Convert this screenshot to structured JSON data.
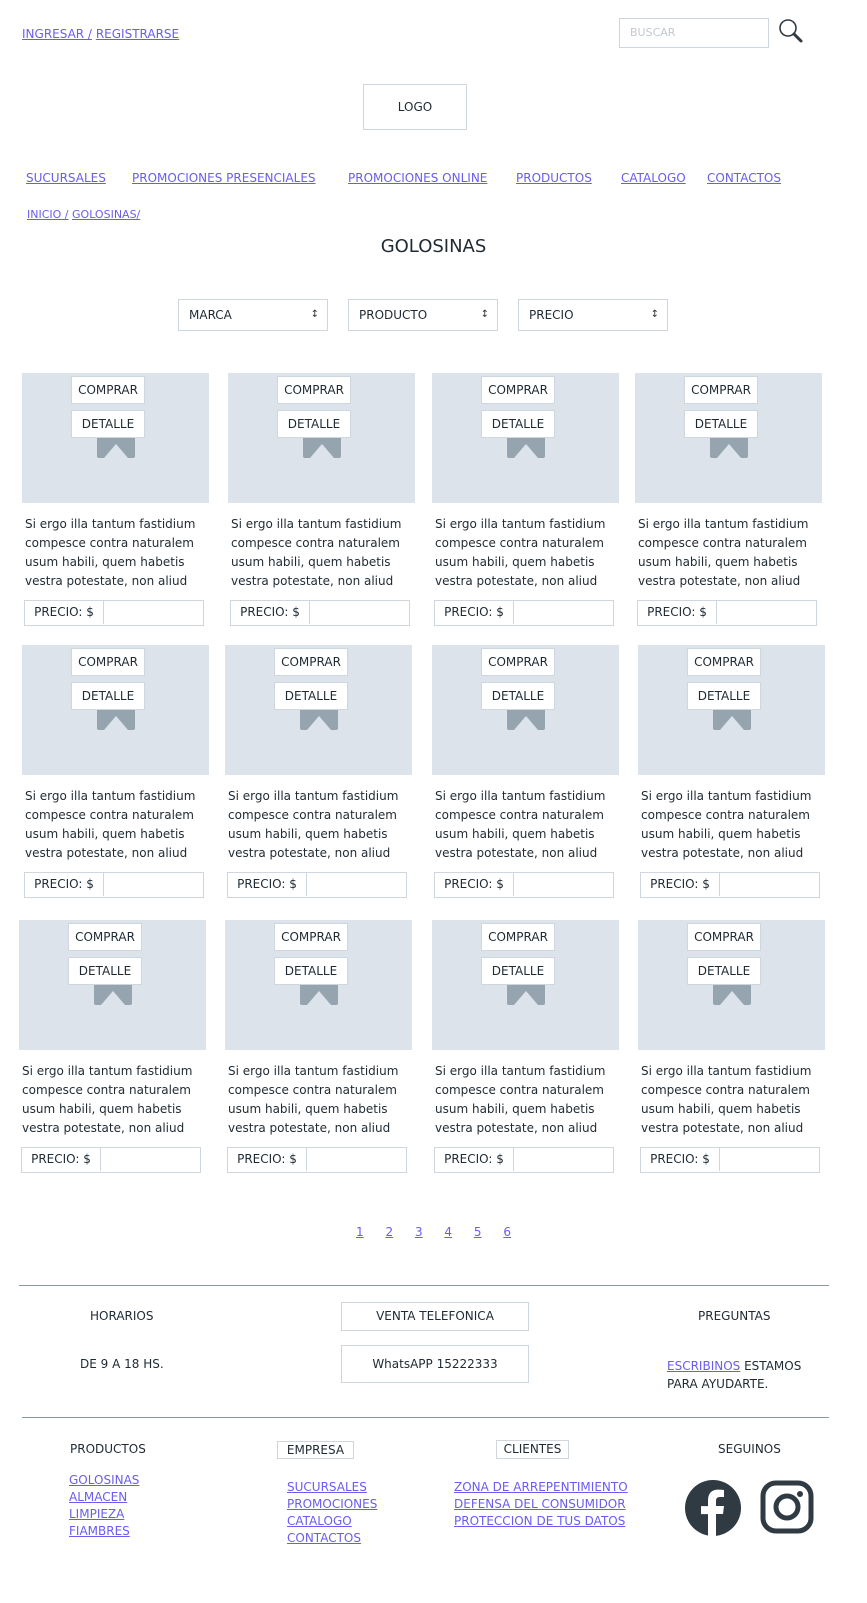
{
  "header": {
    "login": "INGRESAR /",
    "register": "REGISTRARSE",
    "search_placeholder": "BUSCAR",
    "logo": "LOGO"
  },
  "nav": [
    "SUCURSALES",
    "PROMOCIONES PRESENCIALES",
    "PROMOCIONES ONLINE",
    "PRODUCTOS",
    "CATALOGO",
    "CONTACTOS"
  ],
  "breadcrumb": {
    "home": "INICIO /",
    "current": "GOLOSINAS/"
  },
  "page_title": "GOLOSINAS",
  "filters": {
    "brand": "MARCA",
    "product": "PRODUCTO",
    "price": "PRECIO"
  },
  "product_card": {
    "buy": "COMPRAR",
    "detail": "DETALLE",
    "description": "Si ergo illa tantum fastidium compesce contra naturalem usum habili, quem habetis vestra potestate, non aliud",
    "price_label": "PRECIO: $"
  },
  "pagination": [
    "1",
    "2",
    "3",
    "4",
    "5",
    "6"
  ],
  "footer": {
    "hours_title": "HORARIOS",
    "hours_value": "DE 9 A 18 HS.",
    "phone_title": "VENTA TELEFONICA",
    "phone_value": "WhatsAPP 15222333",
    "faq_title": "PREGUNTAS",
    "faq_link": "ESCRIBINOS",
    "faq_text": "ESTAMOS PARA AYUDARTE.",
    "products_title": "PRODUCTOS",
    "products_links": [
      "GOLOSINAS",
      "ALMACEN",
      "LIMPIEZA",
      "FIAMBRES"
    ],
    "company_title": "EMPRESA",
    "company_links": [
      "SUCURSALES",
      "PROMOCIONES",
      "CATALOGO",
      "CONTACTOS"
    ],
    "clients_title": "CLIENTES",
    "clients_links": [
      "ZONA DE ARREPENTIMIENTO",
      "DEFENSA DEL CONSUMIDOR",
      "PROTECCION DE TUS DATOS"
    ],
    "follow_title": "SEGUINOS",
    "social_icons": [
      "facebook-icon",
      "instagram-icon"
    ]
  },
  "colors": {
    "link": "#6a5cf0",
    "placeholder": "#dde3ea",
    "border": "#cfd6de",
    "icon": "#2f3a43"
  }
}
